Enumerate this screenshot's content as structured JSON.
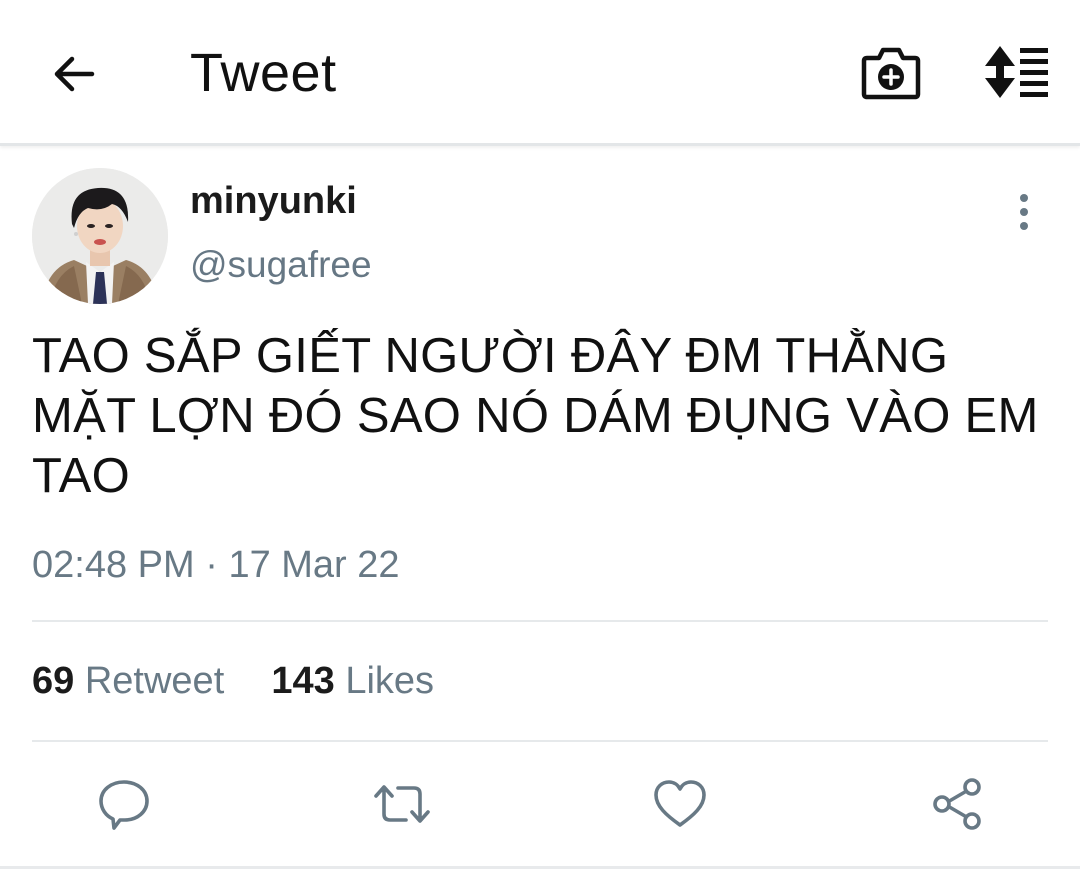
{
  "header": {
    "title": "Tweet",
    "back_icon": "arrow-left-icon",
    "camera_icon": "camera-add-icon",
    "sort_icon": "sort-list-icon"
  },
  "author": {
    "display_name": "minyunki",
    "handle": "@sugafree",
    "avatar_icon": "profile-photo",
    "more_icon": "more-vertical-icon"
  },
  "tweet": {
    "text_lines": [
      "TAO SẮP GIẾT NGƯỜI ĐÂY ĐM THẰNG",
      "MẶT LỢN ĐÓ SAO NÓ DÁM ĐỤNG VÀO EM",
      "TAO"
    ],
    "time": "02:48 PM",
    "separator": "·",
    "date": "17 Mar 22"
  },
  "stats": {
    "retweet_count": "69",
    "retweet_label": "Retweet",
    "likes_count": "143",
    "likes_label": "Likes"
  },
  "actions": {
    "reply_icon": "reply-icon",
    "retweet_icon": "retweet-icon",
    "like_icon": "heart-icon",
    "share_icon": "share-icon"
  },
  "colors": {
    "secondary_text": "#687985",
    "icon_gray": "#687985",
    "divider": "#e6e9eb"
  }
}
